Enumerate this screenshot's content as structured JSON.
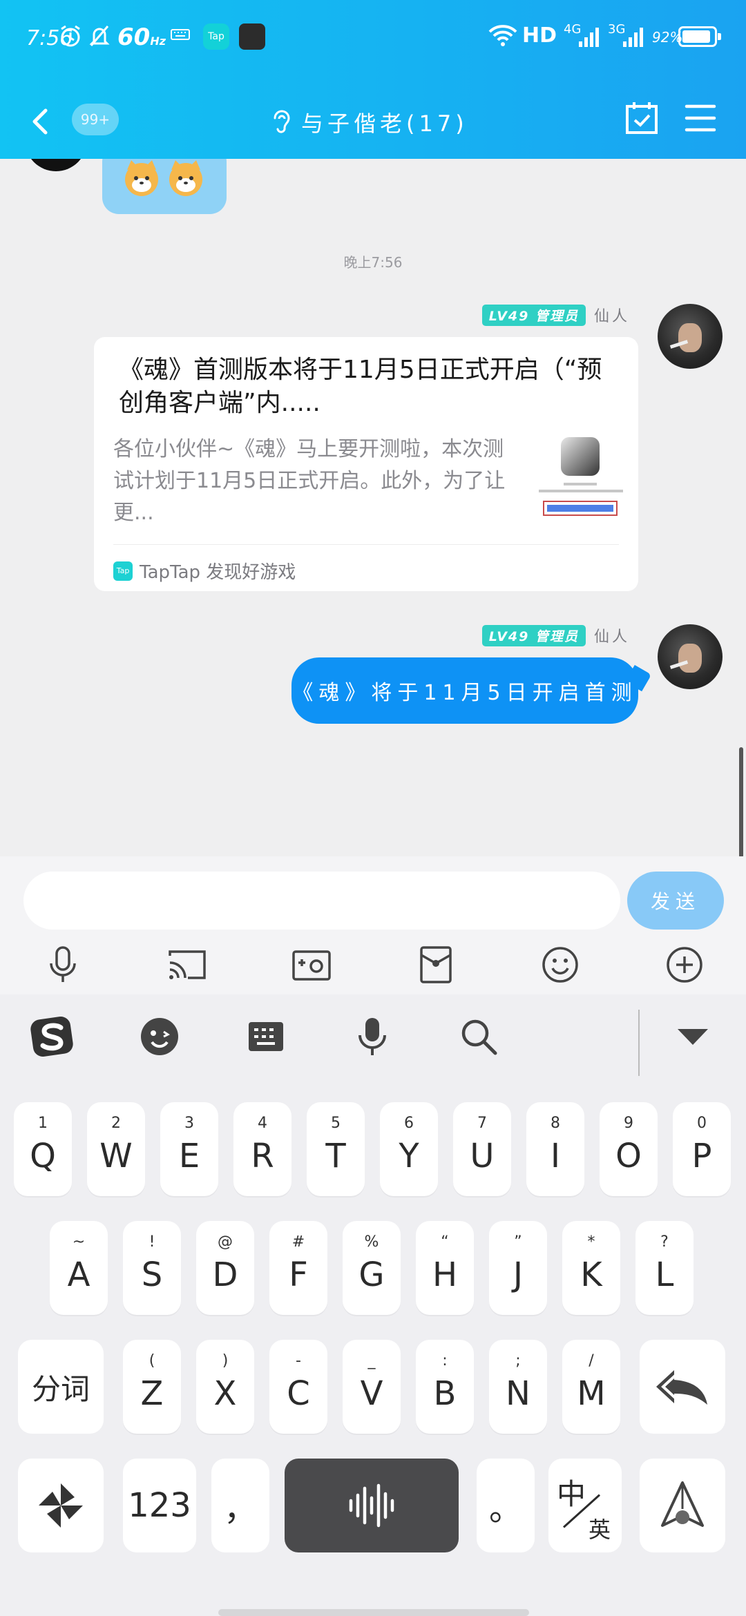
{
  "status_bar": {
    "time": "7:56",
    "refresh": "60",
    "refresh_unit": "Hz",
    "tap_app": "Tap",
    "hd": "HD",
    "net1": "4G",
    "net2": "3G",
    "battery": "92%",
    "battery_level": 0.92
  },
  "nav": {
    "unread_badge": "99+",
    "title": "与子偕老(17)"
  },
  "chat": {
    "timestamp": "晚上7:56",
    "card_message": {
      "level": "LV49 管理员",
      "user": "仙人",
      "title": "《魂》首测版本将于11月5日正式开启（“预创角客户端”内.....",
      "description": "各位小伙伴~《魂》马上要开测啦，本次测试计划于11月5日正式开启。此外，为了让更...",
      "source": "TapTap 发现好游戏",
      "source_logo": "Tap"
    },
    "text_message": {
      "level": "LV49 管理员",
      "user": "仙人",
      "text": "《魂》将于11月5日开启首测"
    }
  },
  "input": {
    "placeholder": "",
    "value": "",
    "send_label": "发送",
    "tools": [
      "microphone-icon",
      "cast-screen-icon",
      "photo-icon",
      "red-packet-icon",
      "emoji-icon",
      "plus-icon"
    ]
  },
  "keyboard": {
    "toolbar": [
      "sogou-logo-icon",
      "emoji-face-icon",
      "keyboard-icon",
      "microphone-icon",
      "search-icon",
      "collapse-icon"
    ],
    "row1": [
      {
        "hint": "1",
        "key": "Q"
      },
      {
        "hint": "2",
        "key": "W"
      },
      {
        "hint": "3",
        "key": "E"
      },
      {
        "hint": "4",
        "key": "R"
      },
      {
        "hint": "5",
        "key": "T"
      },
      {
        "hint": "6",
        "key": "Y"
      },
      {
        "hint": "7",
        "key": "U"
      },
      {
        "hint": "8",
        "key": "I"
      },
      {
        "hint": "9",
        "key": "O"
      },
      {
        "hint": "0",
        "key": "P"
      }
    ],
    "row2": [
      {
        "hint": "~",
        "key": "A"
      },
      {
        "hint": "!",
        "key": "S"
      },
      {
        "hint": "@",
        "key": "D"
      },
      {
        "hint": "#",
        "key": "F"
      },
      {
        "hint": "%",
        "key": "G"
      },
      {
        "hint": "“",
        "key": "H"
      },
      {
        "hint": "”",
        "key": "J"
      },
      {
        "hint": "*",
        "key": "K"
      },
      {
        "hint": "?",
        "key": "L"
      }
    ],
    "row3": [
      {
        "hint": "(",
        "key": "Z"
      },
      {
        "hint": ")",
        "key": "X"
      },
      {
        "hint": "-",
        "key": "C"
      },
      {
        "hint": "_",
        "key": "V"
      },
      {
        "hint": ":",
        "key": "B"
      },
      {
        "hint": ";",
        "key": "N"
      },
      {
        "hint": "/",
        "key": "M"
      }
    ],
    "segment_key": "分词",
    "num_key": "123",
    "comma_key": "，",
    "period_key": "。",
    "lang_key_top": "中",
    "lang_key_bottom": "英"
  }
}
